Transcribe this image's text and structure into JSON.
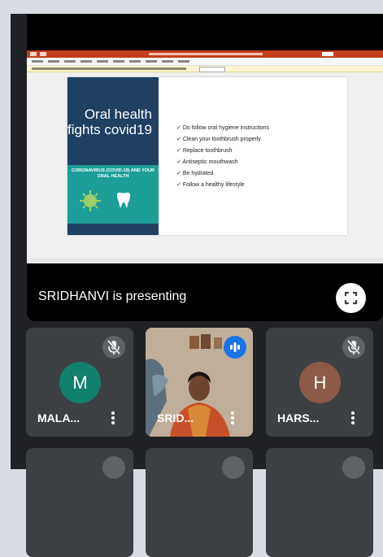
{
  "presentation": {
    "presenter_label": "SRIDHANVI is presenting",
    "fullscreen_icon": "fullscreen-icon",
    "slide": {
      "title": "Oral health fights covid19",
      "band_text": "CORONAVIRUS (COVID-19) AND YOUR ORAL HEALTH",
      "bullets": [
        "Do follow oral hygiene instructions",
        "Clean your toothbrush properly",
        "Replace toothbrush",
        "Antiseptic mouthwash",
        "Be hydrated",
        "Follow a healthy lifestyle"
      ]
    }
  },
  "participants": [
    {
      "initial": "M",
      "name": "MALA...",
      "muted": true,
      "avatar_color": "#12806c"
    },
    {
      "initial": "",
      "name": "SRID...",
      "muted": false,
      "speaking": true
    },
    {
      "initial": "H",
      "name": "HARS...",
      "muted": true,
      "avatar_color": "#8d5a48"
    }
  ],
  "colors": {
    "background": "#202124",
    "tile": "#3c4043",
    "accent_blue": "#1a73e8",
    "slide_navy": "#1f3f63",
    "slide_teal": "#1d9e98"
  }
}
